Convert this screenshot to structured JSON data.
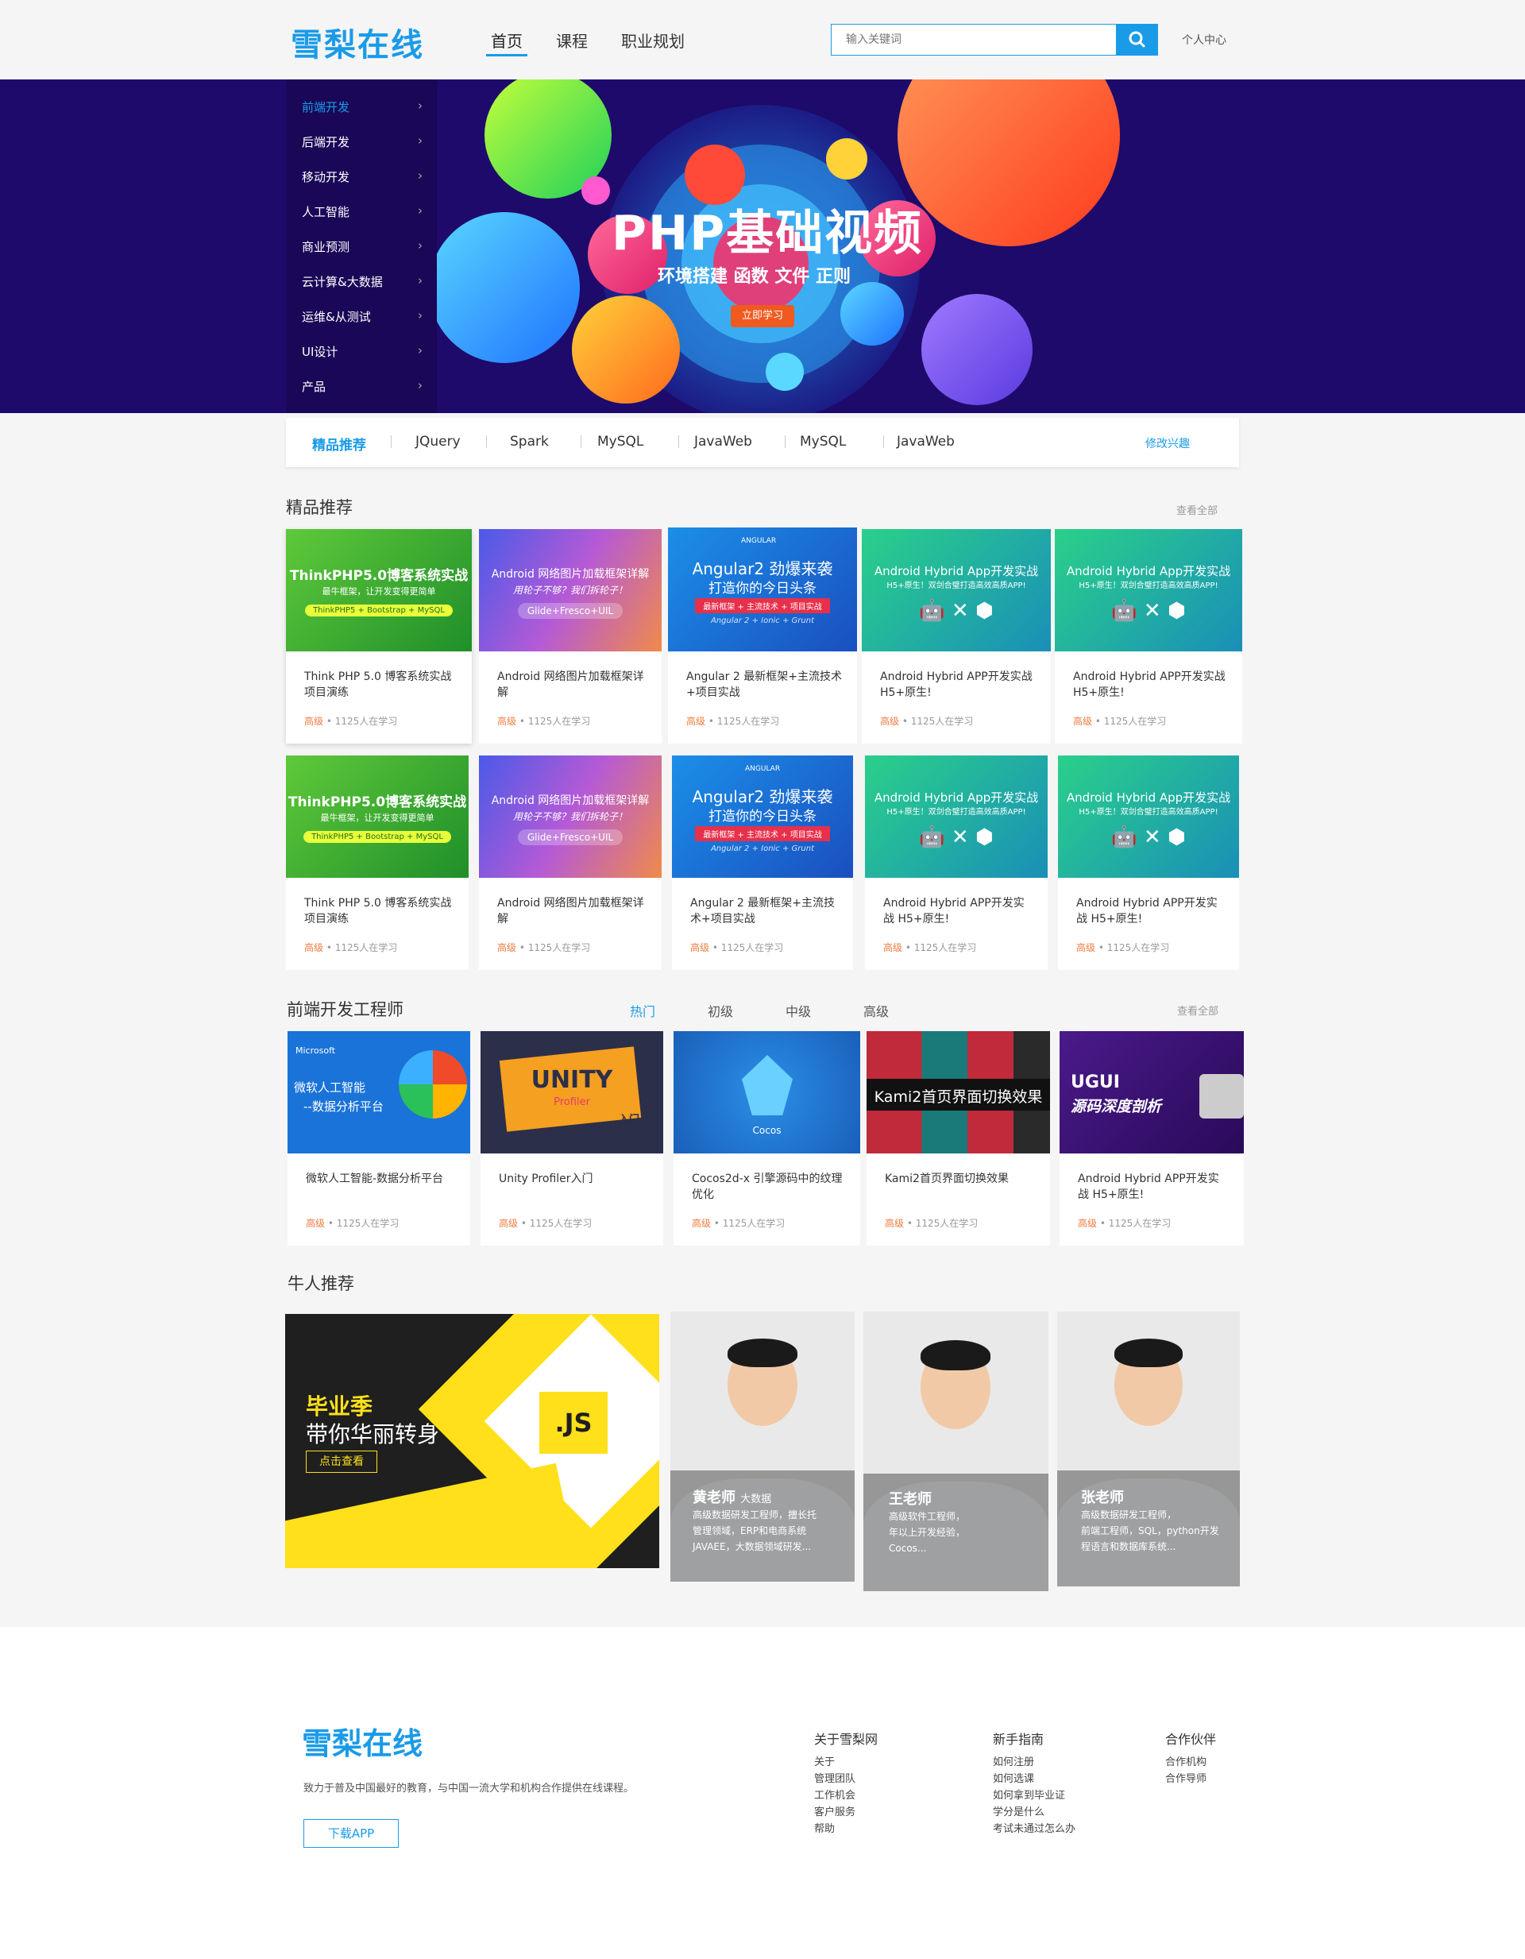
{
  "brand": {
    "logo": "雪梨在线",
    "accent": "#1a9be8"
  },
  "header": {
    "nav": [
      {
        "label": "首页"
      },
      {
        "label": "课程"
      },
      {
        "label": "职业规划"
      }
    ],
    "search_placeholder": "输入关键词",
    "user_center": "个人中心"
  },
  "banner": {
    "categories": [
      {
        "label": "前端开发"
      },
      {
        "label": "后端开发"
      },
      {
        "label": "移动开发"
      },
      {
        "label": "人工智能"
      },
      {
        "label": "商业预测"
      },
      {
        "label": "云计算&大数据"
      },
      {
        "label": "运维&从测试"
      },
      {
        "label": "UI设计"
      },
      {
        "label": "产品"
      }
    ],
    "chevron": "›",
    "title": "PHP基础视频",
    "subtitle": "环境搭建  函数  文件  正则",
    "button": "立即学习"
  },
  "tags": {
    "items": [
      {
        "label": "精品推荐"
      },
      {
        "label": "JQuery"
      },
      {
        "label": "Spark"
      },
      {
        "label": "MySQL"
      },
      {
        "label": "JavaWeb"
      },
      {
        "label": "MySQL"
      },
      {
        "label": "JavaWeb"
      }
    ],
    "edit": "修改兴趣"
  },
  "featured": {
    "title": "精品推荐",
    "see_all": "查看全部",
    "level": "高级",
    "sep": "•",
    "students": "1125人在学习",
    "cards": [
      {
        "thumb_title": "ThinkPHP5.0博客系统实战",
        "thumb_sub": "最牛框架，让开发变得更简单",
        "thumb_pill": "ThinkPHP5 + Bootstrap + MySQL",
        "title": "Think PHP 5.0 博客系统实战项目演练"
      },
      {
        "thumb_title": "Android 网络图片加载框架详解",
        "thumb_sub": "用轮子不够？我们拆轮子！",
        "thumb_pill": "Glide+Fresco+UIL",
        "title": "Android 网络图片加载框架详解"
      },
      {
        "thumb_title": "Angular2 劲爆来袭",
        "thumb_sub": "打造你的今日头条",
        "thumb_pill": "最新框架 + 主流技术 + 项目实战",
        "thumb_foot": "Angular 2 + Ionic + Grunt",
        "thumb_badge": "ANGULAR",
        "title": "Angular 2 最新框架+主流技术+项目实战"
      },
      {
        "thumb_title": "Android Hybrid App开发实战",
        "thumb_sub": "H5+原生！双剑合璧打造高效高质APP!",
        "title": "Android Hybrid APP开发实战 H5+原生!"
      },
      {
        "thumb_title": "Android Hybrid App开发实战",
        "thumb_sub": "H5+原生！双剑合璧打造高效高质APP!",
        "title": "Android Hybrid APP开发实战 H5+原生!"
      },
      {
        "thumb_title": "ThinkPHP5.0博客系统实战",
        "thumb_sub": "最牛框架，让开发变得更简单",
        "thumb_pill": "ThinkPHP5 + Bootstrap + MySQL",
        "title": "Think PHP 5.0 博客系统实战项目演练"
      },
      {
        "thumb_title": "Android 网络图片加载框架详解",
        "thumb_sub": "用轮子不够？我们拆轮子！",
        "thumb_pill": "Glide+Fresco+UIL",
        "title": "Android 网络图片加载框架详解"
      },
      {
        "thumb_title": "Angular2 劲爆来袭",
        "thumb_sub": "打造你的今日头条",
        "thumb_pill": "最新框架 + 主流技术 + 项目实战",
        "thumb_foot": "Angular 2 + Ionic + Grunt",
        "thumb_badge": "ANGULAR",
        "title": "Angular 2 最新框架+主流技术+项目实战"
      },
      {
        "thumb_title": "Android Hybrid App开发实战",
        "thumb_sub": "H5+原生！双剑合璧打造高效高质APP!",
        "title": "Android Hybrid APP开发实战 H5+原生!"
      },
      {
        "thumb_title": "Android Hybrid App开发实战",
        "thumb_sub": "H5+原生！双剑合璧打造高效高质APP!",
        "title": "Android Hybrid APP开发实战 H5+原生!"
      }
    ]
  },
  "frontend": {
    "title": "前端开发工程师",
    "tabs": [
      {
        "label": "热门"
      },
      {
        "label": "初级"
      },
      {
        "label": "中级"
      },
      {
        "label": "高级"
      }
    ],
    "see_all": "查看全部",
    "cards": [
      {
        "thumb_brand": "Microsoft",
        "thumb_title": "微软人工智能",
        "thumb_sub": "--数据分析平台",
        "title": "微软人工智能-数据分析平台"
      },
      {
        "thumb_title": "UNITY",
        "thumb_sub": "Profiler",
        "thumb_pill": "入门",
        "title": "Unity Profiler入门"
      },
      {
        "thumb_title": "Cocos",
        "title": "Cocos2d-x  引擎源码中的纹理优化"
      },
      {
        "thumb_title": "Kami2首页界面切换效果",
        "title": "Kami2首页界面切换效果"
      },
      {
        "thumb_title": "UGUI",
        "thumb_sub": "源码深度剖析",
        "title": "Android Hybrid APP开发实战 H5+原生!"
      }
    ]
  },
  "experts": {
    "title": "牛人推荐",
    "promo": {
      "line1": "毕业季",
      "line2": "带你华丽转身",
      "button": "点击查看",
      "badge": ".JS"
    },
    "teachers": [
      {
        "name": "黄老师",
        "tag": "大数据",
        "desc": [
          "高级数据研发工程师，擅长托",
          "管理领域，ERP和电商系统",
          "JAVAEE，大数据领域研发..."
        ]
      },
      {
        "name": "王老师",
        "tag": "",
        "desc": [
          "高级软件工程师，",
          "年以上开发经验，",
          "Cocos..."
        ]
      },
      {
        "name": "张老师",
        "tag": "",
        "desc": [
          "高级数据研发工程师，",
          "前端工程师，SQL，python开发",
          "程语言和数据库系统..."
        ]
      }
    ]
  },
  "footer": {
    "logo": "雪梨在线",
    "desc": "致力于普及中国最好的教育，与中国一流大学和机构合作提供在线课程。",
    "app_button": "下载APP",
    "columns": [
      {
        "title": "关于雪梨网",
        "links": [
          "关于",
          "管理团队",
          "工作机会",
          "客户服务",
          "帮助"
        ]
      },
      {
        "title": "新手指南",
        "links": [
          "如何注册",
          "如何选课",
          "如何拿到毕业证",
          "学分是什么",
          "考试未通过怎么办"
        ]
      },
      {
        "title": "合作伙伴",
        "links": [
          "合作机构",
          "合作导师"
        ]
      }
    ]
  }
}
